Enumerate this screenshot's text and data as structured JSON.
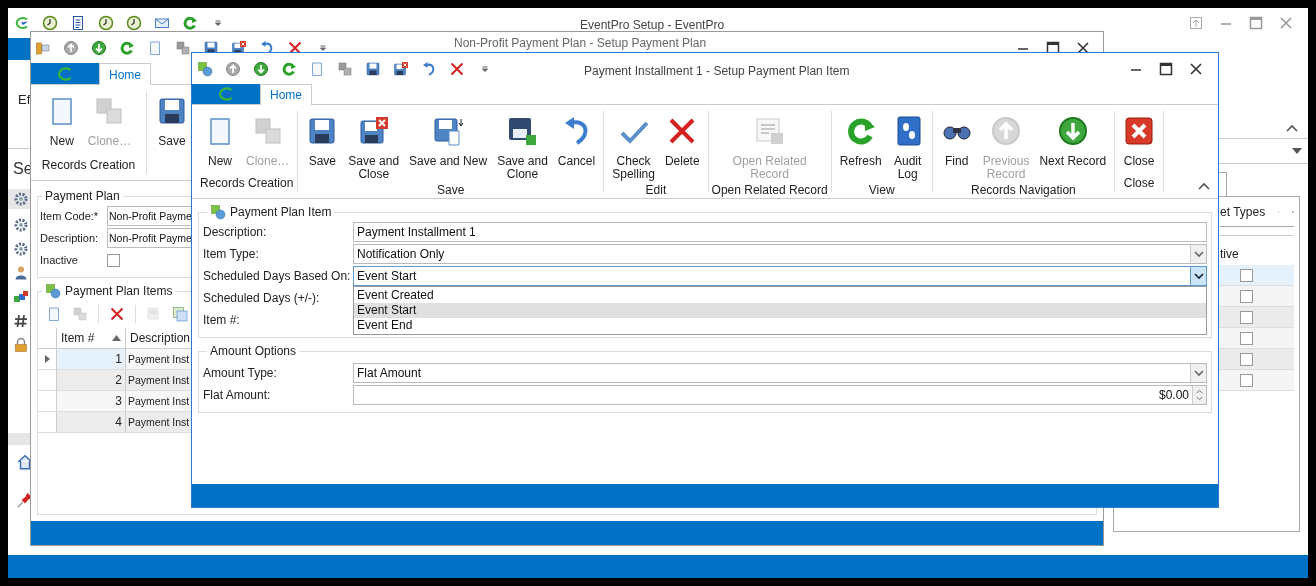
{
  "main_window": {
    "title": "EventPro Setup - EventPro",
    "side_labels": [
      "Ef",
      "Se"
    ],
    "background_tab": "et Types",
    "background_column": "tive",
    "background_rows": [
      {
        "selected": true,
        "checked": false
      },
      {
        "selected": false,
        "checked": false
      },
      {
        "selected": false,
        "checked": false
      },
      {
        "selected": false,
        "checked": false
      },
      {
        "selected": false,
        "checked": false
      },
      {
        "selected": false,
        "checked": false
      }
    ]
  },
  "plan_window": {
    "title": "Non-Profit Payment Plan - Setup Payment Plan",
    "tab": "Home",
    "ribbon_buttons": [
      {
        "kind": "new",
        "lines": [
          "New"
        ],
        "disabled": false
      },
      {
        "kind": "clone",
        "lines": [
          "Clone…"
        ],
        "disabled": true
      },
      {
        "kind": "save",
        "lines": [
          "Save"
        ],
        "disabled": false
      }
    ],
    "ribbon_group": "Records Creation",
    "plan_group": "Payment Plan",
    "fields": [
      {
        "label": "Item Code:*",
        "value": "Non-Profit Payme"
      },
      {
        "label": "Description:",
        "value": "Non-Profit Payme"
      }
    ],
    "inactive": {
      "label": "Inactive",
      "checked": false
    },
    "items_group": "Payment Plan Items",
    "columns": [
      "Item #",
      "Description"
    ],
    "rows": [
      {
        "number": "1",
        "description": "Payment Inst",
        "selected": true
      },
      {
        "number": "2",
        "description": "Payment Inst",
        "selected": false
      },
      {
        "number": "3",
        "description": "Payment Inst",
        "selected": false
      },
      {
        "number": "4",
        "description": "Payment Inst",
        "selected": false
      }
    ]
  },
  "item_window": {
    "title": "Payment Installment 1 - Setup Payment Plan Item",
    "tab": "Home",
    "ribbon_groups": [
      {
        "label": "Records Creation",
        "buttons": [
          {
            "kind": "new",
            "lines": [
              "New"
            ],
            "disabled": false
          },
          {
            "kind": "clone",
            "lines": [
              "Clone…"
            ],
            "disabled": true
          }
        ]
      },
      {
        "label": "Save",
        "buttons": [
          {
            "kind": "save",
            "lines": [
              "Save"
            ],
            "disabled": false
          },
          {
            "kind": "save_close",
            "lines": [
              "Save and",
              "Close"
            ],
            "disabled": false
          },
          {
            "kind": "save_new",
            "lines": [
              "Save and New"
            ],
            "disabled": false
          },
          {
            "kind": "save_clone",
            "lines": [
              "Save and",
              "Clone"
            ],
            "disabled": false
          },
          {
            "kind": "cancel",
            "lines": [
              "Cancel"
            ],
            "disabled": false
          }
        ]
      },
      {
        "label": "Edit",
        "buttons": [
          {
            "kind": "spelling",
            "lines": [
              "Check",
              "Spelling"
            ],
            "disabled": false
          },
          {
            "kind": "delete",
            "lines": [
              "Delete"
            ],
            "disabled": false
          }
        ]
      },
      {
        "label": "Open Related Record",
        "buttons": [
          {
            "kind": "related",
            "lines": [
              "Open Related",
              "Record"
            ],
            "disabled": true
          }
        ]
      },
      {
        "label": "View",
        "buttons": [
          {
            "kind": "refresh",
            "lines": [
              "Refresh"
            ],
            "disabled": false
          },
          {
            "kind": "audit",
            "lines": [
              "Audit",
              "Log"
            ],
            "disabled": false
          }
        ]
      },
      {
        "label": "Records Navigation",
        "buttons": [
          {
            "kind": "find",
            "lines": [
              "Find"
            ],
            "disabled": false
          },
          {
            "kind": "previous",
            "lines": [
              "Previous",
              "Record"
            ],
            "disabled": true
          },
          {
            "kind": "next",
            "lines": [
              "Next Record"
            ],
            "disabled": false
          }
        ]
      },
      {
        "label": "Close",
        "buttons": [
          {
            "kind": "close",
            "lines": [
              "Close"
            ],
            "disabled": false
          }
        ]
      }
    ],
    "item_group": "Payment Plan Item",
    "fields": [
      {
        "kind": "text",
        "label": "Description:",
        "value": "Payment Installment 1"
      },
      {
        "kind": "dropdown",
        "label": "Item Type:",
        "value": "Notification Only",
        "open": false
      },
      {
        "kind": "dropdown",
        "label": "Scheduled Days Based On:",
        "value": "Event Start",
        "open": true,
        "options": [
          {
            "label": "Event Created",
            "selected": false
          },
          {
            "label": "Event Start",
            "selected": true
          },
          {
            "label": "Event End",
            "selected": false
          }
        ]
      },
      {
        "kind": "label_only",
        "label": "Scheduled Days (+/-):"
      },
      {
        "kind": "label_only",
        "label": "Item #:"
      }
    ],
    "amount_group": "Amount Options",
    "amount_fields": [
      {
        "kind": "dropdown",
        "label": "Amount Type:",
        "value": "Flat Amount",
        "open": false
      },
      {
        "kind": "spin",
        "label": "Flat Amount:",
        "value": "$0.00"
      }
    ]
  }
}
